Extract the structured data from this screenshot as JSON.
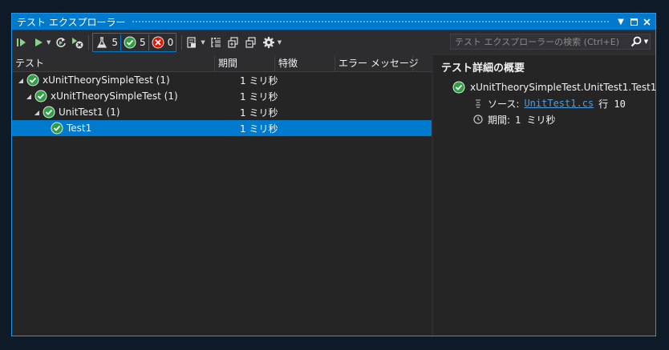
{
  "window": {
    "title": "テスト エクスプローラー"
  },
  "toolbar": {
    "filters": [
      {
        "icon": "flask-icon",
        "count": "5"
      },
      {
        "icon": "passed-icon",
        "count": "5"
      },
      {
        "icon": "failed-icon",
        "count": "0"
      }
    ],
    "search_placeholder": "テスト エクスプローラーの検索 (Ctrl+E)"
  },
  "columns": [
    "テスト",
    "期間",
    "特徴",
    "エラー メッセージ"
  ],
  "tests": [
    {
      "name": "xUnitTheorySimpleTest (1)",
      "duration": "1 ミリ秒"
    },
    {
      "name": "xUnitTheorySimpleTest (1)",
      "duration": "1 ミリ秒"
    },
    {
      "name": "UnitTest1 (1)",
      "duration": "1 ミリ秒"
    },
    {
      "name": "Test1",
      "duration": "1 ミリ秒"
    }
  ],
  "details": {
    "title": "テスト詳細の概要",
    "test_name": "xUnitTheorySimpleTest.UnitTest1.Test1",
    "source_label": "ソース:",
    "source_file": "UnitTest1.cs",
    "source_line": "行 10",
    "duration_label": "期間:",
    "duration_value": "1 ミリ秒"
  },
  "colors": {
    "accent": "#007acc",
    "pass": "#2ea043",
    "fail": "#e51400",
    "background": "#252526"
  }
}
